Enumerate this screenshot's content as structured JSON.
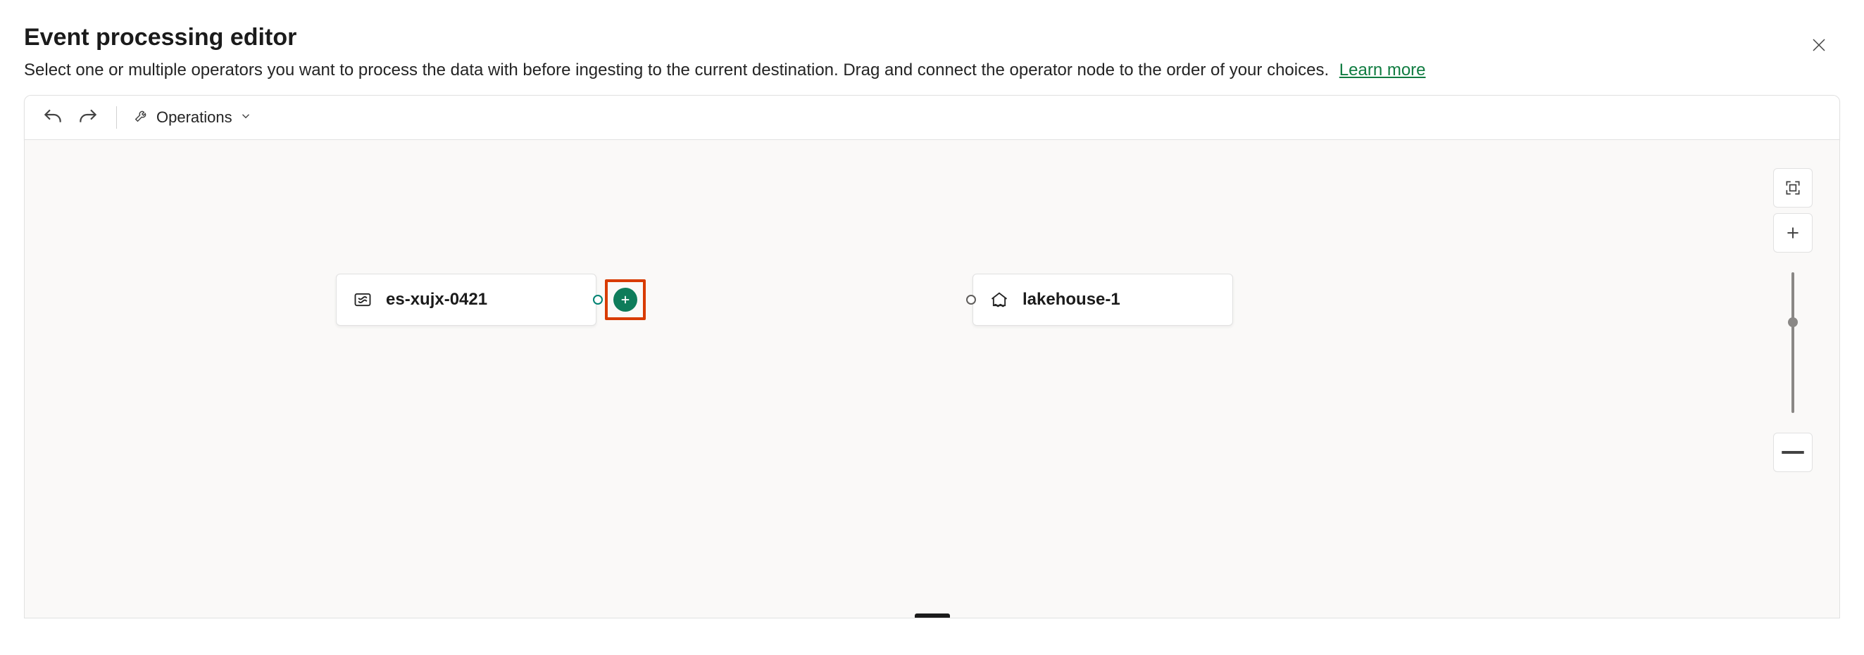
{
  "header": {
    "title": "Event processing editor",
    "subtitle": "Select one or multiple operators you want to process the data with before ingesting to the current destination. Drag and connect the operator node to the order of your choices.",
    "learn_more": "Learn more"
  },
  "toolbar": {
    "undo_icon": "undo",
    "redo_icon": "redo",
    "operations_label": "Operations"
  },
  "nodes": {
    "source": {
      "label": "es-xujx-0421",
      "icon": "eventstream"
    },
    "destination": {
      "label": "lakehouse-1",
      "icon": "lakehouse"
    }
  },
  "add_button": {
    "highlight_color": "#d83b01",
    "fill_color": "#0e7c5a"
  },
  "zoom": {
    "fit_icon": "fit",
    "in_icon": "plus",
    "out_icon": "minus"
  }
}
